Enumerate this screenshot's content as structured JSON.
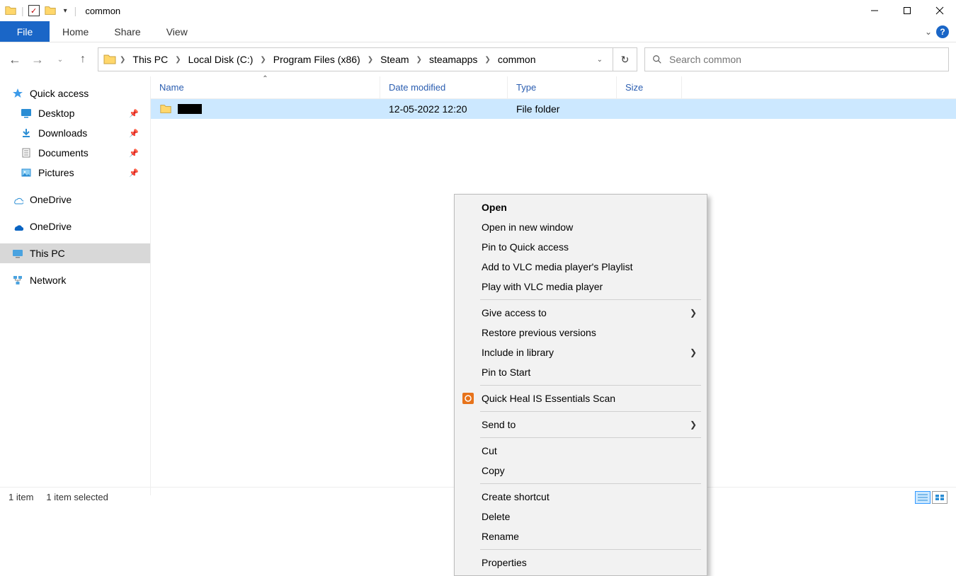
{
  "window": {
    "title": "common"
  },
  "ribbon": {
    "file": "File",
    "tabs": [
      "Home",
      "Share",
      "View"
    ]
  },
  "breadcrumb": {
    "segments": [
      "This PC",
      "Local Disk (C:)",
      "Program Files (x86)",
      "Steam",
      "steamapps",
      "common"
    ]
  },
  "search": {
    "placeholder": "Search common"
  },
  "sidebar": {
    "quick_access": "Quick access",
    "quick_items": [
      {
        "label": "Desktop",
        "pinned": true
      },
      {
        "label": "Downloads",
        "pinned": true
      },
      {
        "label": "Documents",
        "pinned": true
      },
      {
        "label": "Pictures",
        "pinned": true
      }
    ],
    "onedrive1": "OneDrive",
    "onedrive2": "OneDrive",
    "this_pc": "This PC",
    "network": "Network"
  },
  "columns": {
    "name": "Name",
    "date": "Date modified",
    "type": "Type",
    "size": "Size"
  },
  "files": [
    {
      "name": "",
      "date": "12-05-2022 12:20",
      "type": "File folder",
      "redacted": true
    }
  ],
  "context_menu": {
    "items": [
      {
        "label": "Open",
        "bold": true
      },
      {
        "label": "Open in new window"
      },
      {
        "label": "Pin to Quick access"
      },
      {
        "label": "Add to VLC media player's Playlist"
      },
      {
        "label": "Play with VLC media player"
      },
      {
        "sep": true
      },
      {
        "label": "Give access to",
        "submenu": true
      },
      {
        "label": "Restore previous versions"
      },
      {
        "label": "Include in library",
        "submenu": true
      },
      {
        "label": "Pin to Start"
      },
      {
        "sep": true
      },
      {
        "label": "Quick Heal IS Essentials Scan",
        "icon": "quickheal"
      },
      {
        "sep": true
      },
      {
        "label": "Send to",
        "submenu": true
      },
      {
        "sep": true
      },
      {
        "label": "Cut"
      },
      {
        "label": "Copy"
      },
      {
        "sep": true
      },
      {
        "label": "Create shortcut"
      },
      {
        "label": "Delete",
        "highlight": true
      },
      {
        "label": "Rename"
      },
      {
        "sep": true
      },
      {
        "label": "Properties"
      }
    ]
  },
  "status": {
    "count": "1 item",
    "selection": "1 item selected"
  }
}
